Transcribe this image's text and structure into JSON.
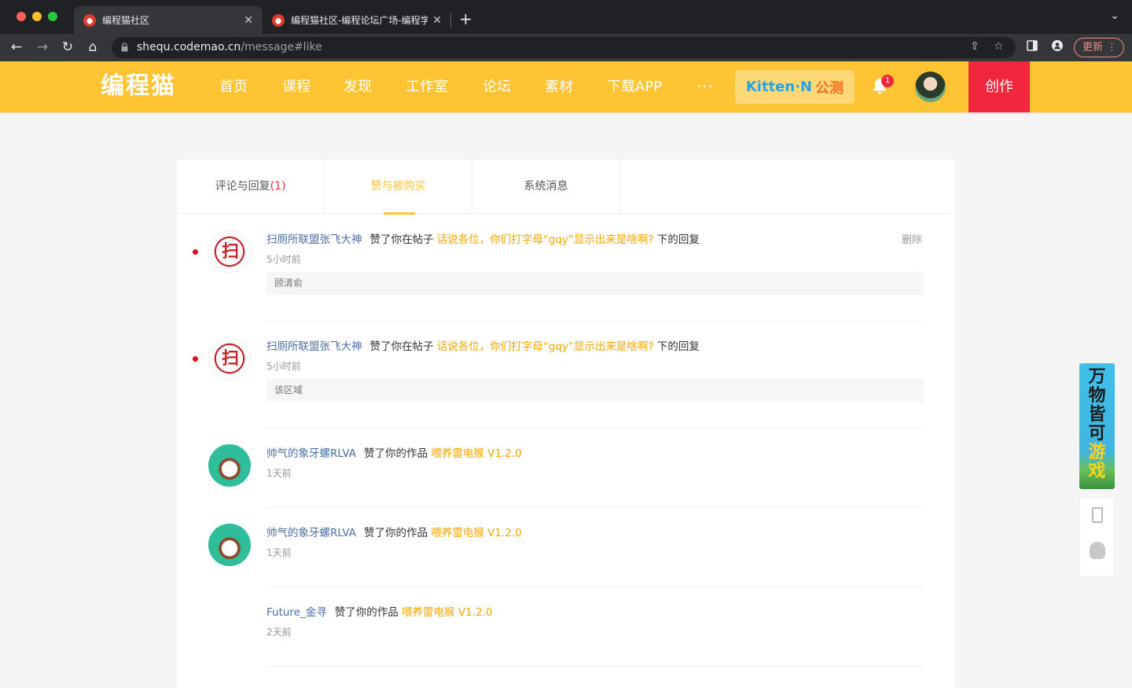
{
  "browser": {
    "tabs": [
      {
        "title": "编程猫社区",
        "active": true
      },
      {
        "title": "编程猫社区-编程论坛广场-编程学",
        "active": false
      }
    ],
    "url_host": "shequ.codemao.cn",
    "url_path": "/message#like",
    "update_label": "更新"
  },
  "site": {
    "logo": "编程猫",
    "nav": [
      "首页",
      "课程",
      "发现",
      "工作室",
      "论坛",
      "素材",
      "下载APP"
    ],
    "more": "···",
    "kitten_brand": "Kitten·N",
    "kitten_beta": "公测",
    "notification_count": "1",
    "create_label": "创作",
    "accent_color": "#fec433",
    "create_color": "#f0263e"
  },
  "tabs": [
    {
      "label": "评论与回复",
      "count": "(1)"
    },
    {
      "label": "赞与被购买",
      "count": ""
    },
    {
      "label": "系统消息",
      "count": ""
    }
  ],
  "messages": [
    {
      "user": "扫厕所联盟张飞大神",
      "action": "赞了你在帖子",
      "target": "话说各位，你们打字母“gqy”显示出来是啥啊?",
      "suffix": "下的回复",
      "time": "5小时前",
      "quote": "顾清俞",
      "unread": true,
      "delete_label": "删除",
      "avatar": "sao"
    },
    {
      "user": "扫厕所联盟张飞大神",
      "action": "赞了你在帖子",
      "target": "话说各位，你们打字母“gqy”显示出来是啥啊?",
      "suffix": "下的回复",
      "time": "5小时前",
      "quote": "该区域",
      "unread": true,
      "avatar": "sao"
    },
    {
      "user": "帅气的象牙螺RLVA",
      "action": "赞了你的作品",
      "target": "喂养雷电猴 V1.2.0",
      "time": "1天前",
      "avatar": "cute"
    },
    {
      "user": "帅气的象牙螺RLVA",
      "action": "赞了你的作品",
      "target": "喂养雷电猴 V1.2.0",
      "time": "1天前",
      "avatar": "cute"
    },
    {
      "user": "Future_金寻",
      "action": "赞了你的作品",
      "target": "喂养雷电猴 V1.2.0",
      "time": "2天前",
      "avatar": "none"
    }
  ],
  "promo": {
    "line1": "万物皆可",
    "line2": "游戏"
  }
}
